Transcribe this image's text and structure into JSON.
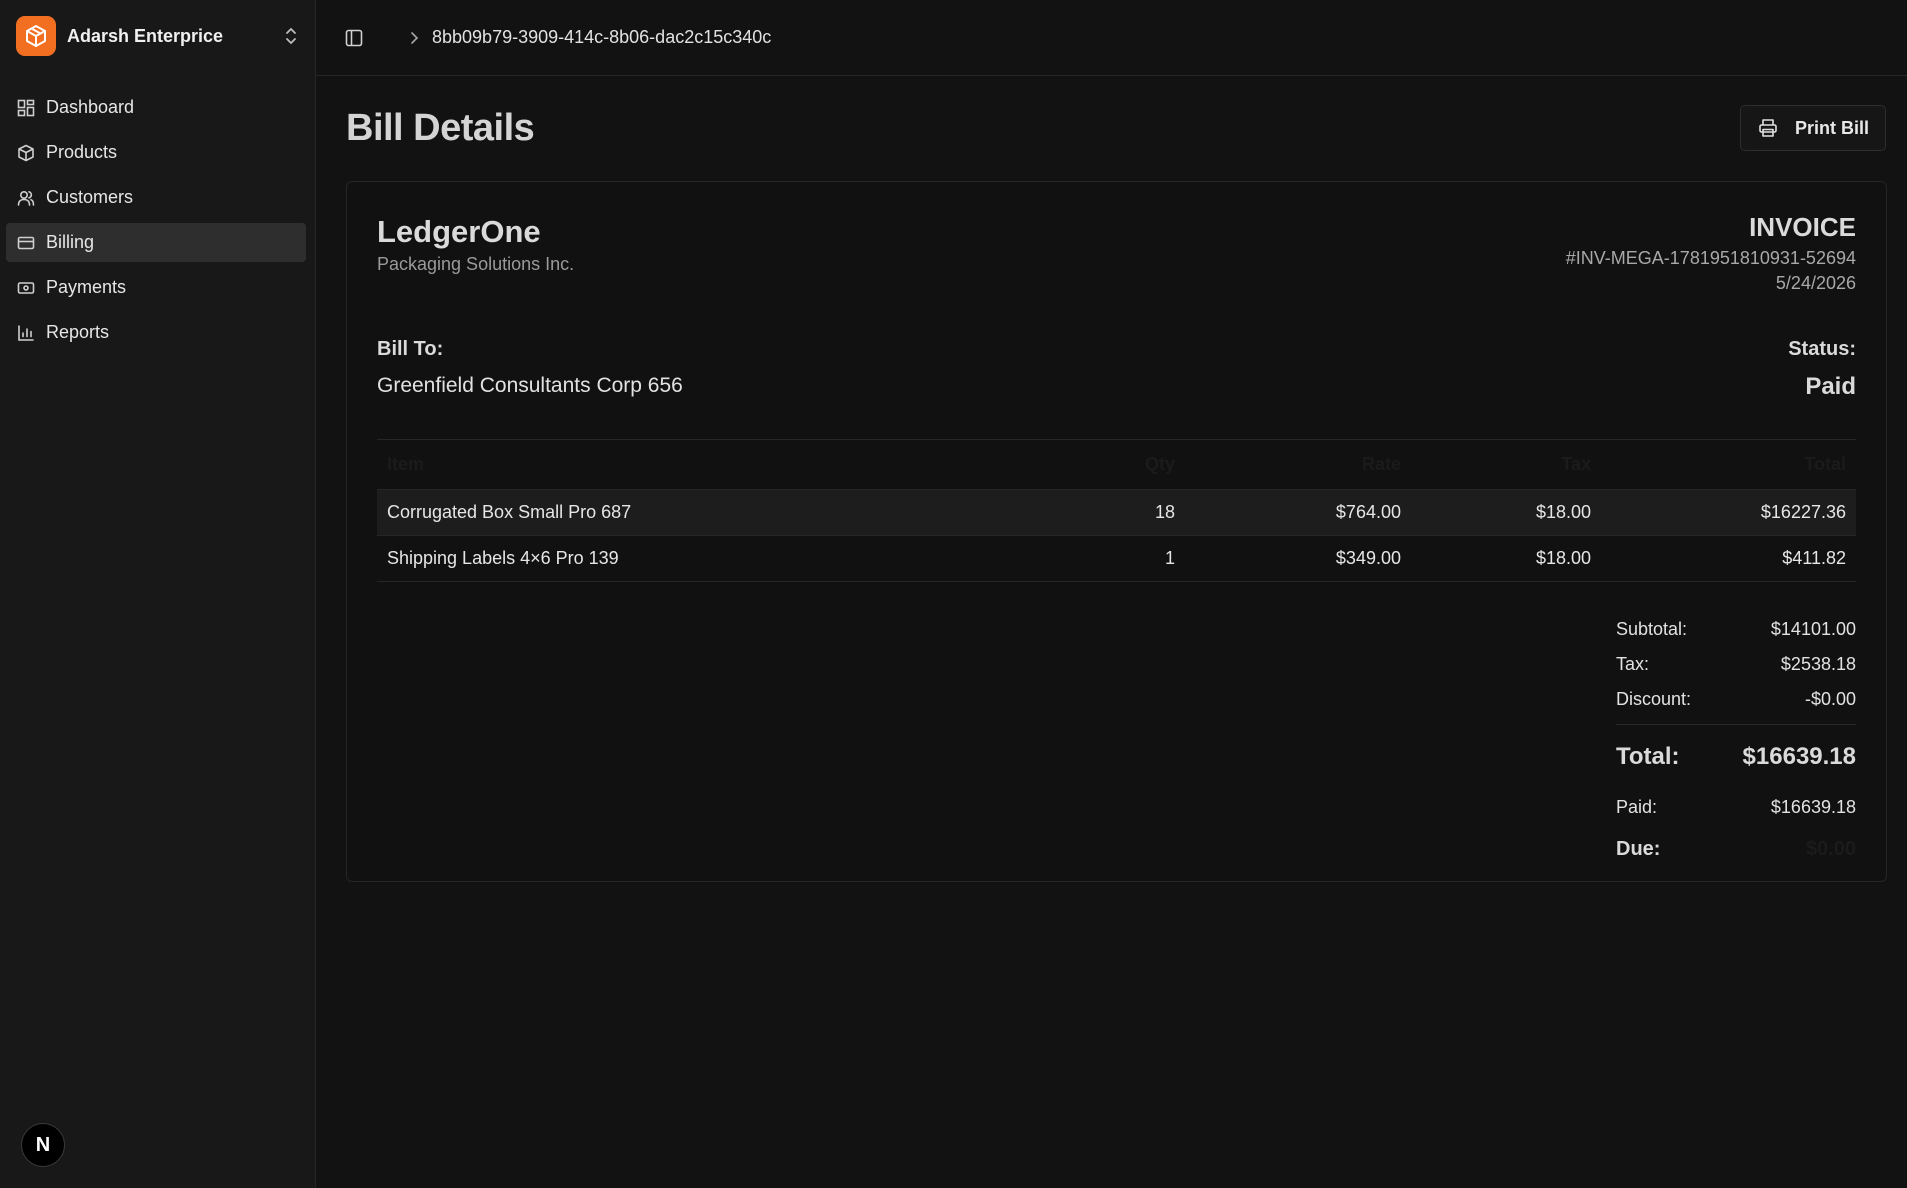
{
  "sidebar": {
    "org_name": "Adarsh Enterprice",
    "items": [
      {
        "label": "Dashboard",
        "icon": "dashboard-icon"
      },
      {
        "label": "Products",
        "icon": "box-icon"
      },
      {
        "label": "Customers",
        "icon": "users-icon"
      },
      {
        "label": "Billing",
        "icon": "card-icon",
        "active": true
      },
      {
        "label": "Payments",
        "icon": "banknote-icon"
      },
      {
        "label": "Reports",
        "icon": "bar-chart-icon"
      }
    ],
    "footer_badge": "N"
  },
  "topbar": {
    "breadcrumb": "8bb09b79-3909-414c-8b06-dac2c15c340c"
  },
  "page": {
    "title": "Bill Details",
    "print_label": "Print Bill"
  },
  "invoice": {
    "company_name": "LedgerOne",
    "company_sub": "Packaging Solutions Inc.",
    "title": "INVOICE",
    "number": "#INV-MEGA-1781951810931-52694",
    "date": "5/24/2026",
    "bill_to_label": "Bill To:",
    "bill_to_name": "Greenfield Consultants Corp 656",
    "status_label": "Status:",
    "status_value": "Paid",
    "columns": [
      "Item",
      "Qty",
      "Rate",
      "Tax",
      "Total"
    ],
    "rows": [
      {
        "item": "Corrugated Box Small Pro 687",
        "qty": "18",
        "rate": "$764.00",
        "tax": "$18.00",
        "total": "$16227.36"
      },
      {
        "item": "Shipping Labels 4×6 Pro 139",
        "qty": "1",
        "rate": "$349.00",
        "tax": "$18.00",
        "total": "$411.82"
      }
    ],
    "totals": {
      "subtotal_label": "Subtotal:",
      "subtotal": "$14101.00",
      "tax_label": "Tax:",
      "tax": "$2538.18",
      "discount_label": "Discount:",
      "discount": "-$0.00",
      "total_label": "Total:",
      "total": "$16639.18",
      "paid_label": "Paid:",
      "paid": "$16639.18",
      "due_label": "Due:",
      "due": "$0.00"
    }
  },
  "colors": {
    "accent": "#f26f22",
    "background": "#121212",
    "sidebar": "#181818",
    "active_nav": "#2e2e2e"
  }
}
